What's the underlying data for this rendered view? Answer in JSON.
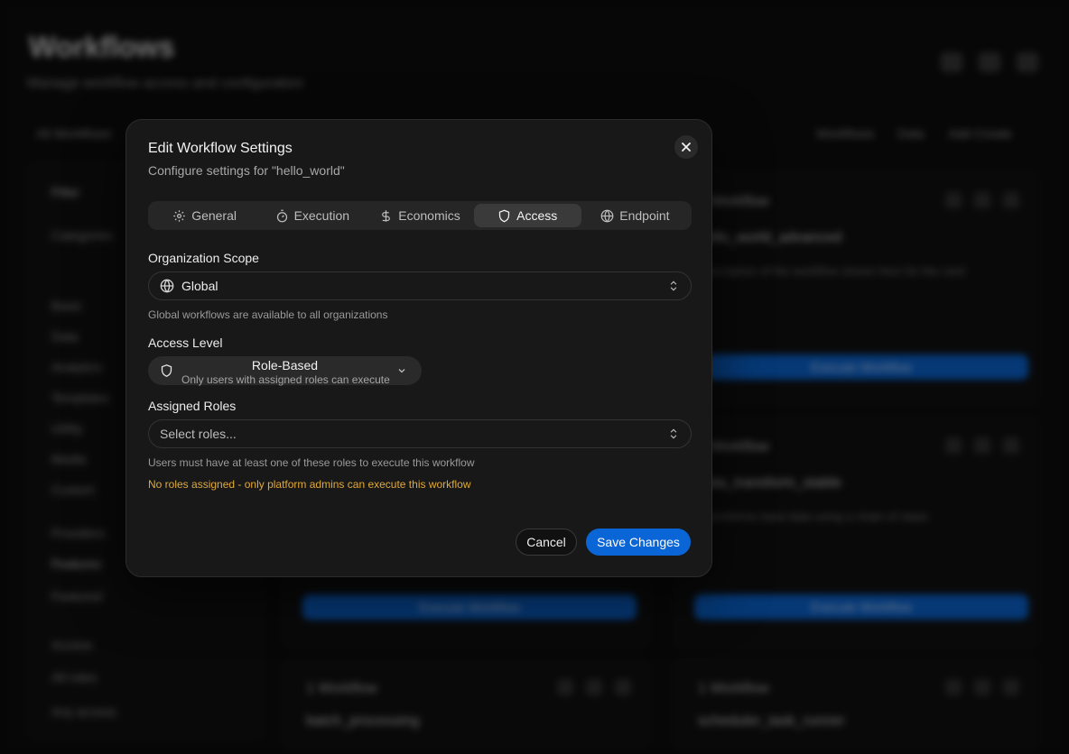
{
  "dialog": {
    "title": "Edit Workflow Settings",
    "description": "Configure settings for \"hello_world\"",
    "tabs": [
      {
        "label": "General",
        "icon": "gear-icon"
      },
      {
        "label": "Execution",
        "icon": "timer-icon"
      },
      {
        "label": "Economics",
        "icon": "dollar-icon"
      },
      {
        "label": "Access",
        "icon": "shield-icon",
        "active": true
      },
      {
        "label": "Endpoint",
        "icon": "globe-icon"
      }
    ],
    "org_scope": {
      "label": "Organization Scope",
      "value": "Global",
      "helper": "Global workflows are available to all organizations"
    },
    "access_level": {
      "label": "Access Level",
      "value": "Role-Based",
      "description": "Only users with assigned roles can execute"
    },
    "assigned_roles": {
      "label": "Assigned Roles",
      "placeholder": "Select roles...",
      "helper": "Users must have at least one of these roles to execute this workflow",
      "warning": "No roles assigned - only platform admins can execute this workflow"
    },
    "cancel_label": "Cancel",
    "save_label": "Save Changes"
  },
  "colors": {
    "accent": "#0a66d6",
    "warning": "#e0a93a",
    "dialog_bg": "#181818"
  }
}
